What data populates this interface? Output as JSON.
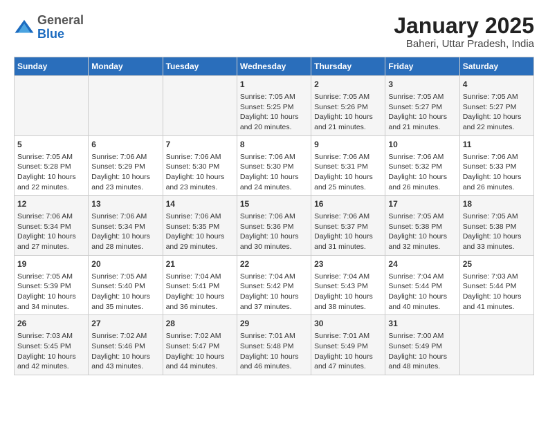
{
  "header": {
    "logo_general": "General",
    "logo_blue": "Blue",
    "title": "January 2025",
    "subtitle": "Baheri, Uttar Pradesh, India"
  },
  "calendar": {
    "days_of_week": [
      "Sunday",
      "Monday",
      "Tuesday",
      "Wednesday",
      "Thursday",
      "Friday",
      "Saturday"
    ],
    "weeks": [
      [
        {
          "day": null,
          "info": null
        },
        {
          "day": null,
          "info": null
        },
        {
          "day": null,
          "info": null
        },
        {
          "day": "1",
          "info": "Sunrise: 7:05 AM\nSunset: 5:25 PM\nDaylight: 10 hours\nand 20 minutes."
        },
        {
          "day": "2",
          "info": "Sunrise: 7:05 AM\nSunset: 5:26 PM\nDaylight: 10 hours\nand 21 minutes."
        },
        {
          "day": "3",
          "info": "Sunrise: 7:05 AM\nSunset: 5:27 PM\nDaylight: 10 hours\nand 21 minutes."
        },
        {
          "day": "4",
          "info": "Sunrise: 7:05 AM\nSunset: 5:27 PM\nDaylight: 10 hours\nand 22 minutes."
        }
      ],
      [
        {
          "day": "5",
          "info": "Sunrise: 7:05 AM\nSunset: 5:28 PM\nDaylight: 10 hours\nand 22 minutes."
        },
        {
          "day": "6",
          "info": "Sunrise: 7:06 AM\nSunset: 5:29 PM\nDaylight: 10 hours\nand 23 minutes."
        },
        {
          "day": "7",
          "info": "Sunrise: 7:06 AM\nSunset: 5:30 PM\nDaylight: 10 hours\nand 23 minutes."
        },
        {
          "day": "8",
          "info": "Sunrise: 7:06 AM\nSunset: 5:30 PM\nDaylight: 10 hours\nand 24 minutes."
        },
        {
          "day": "9",
          "info": "Sunrise: 7:06 AM\nSunset: 5:31 PM\nDaylight: 10 hours\nand 25 minutes."
        },
        {
          "day": "10",
          "info": "Sunrise: 7:06 AM\nSunset: 5:32 PM\nDaylight: 10 hours\nand 26 minutes."
        },
        {
          "day": "11",
          "info": "Sunrise: 7:06 AM\nSunset: 5:33 PM\nDaylight: 10 hours\nand 26 minutes."
        }
      ],
      [
        {
          "day": "12",
          "info": "Sunrise: 7:06 AM\nSunset: 5:34 PM\nDaylight: 10 hours\nand 27 minutes."
        },
        {
          "day": "13",
          "info": "Sunrise: 7:06 AM\nSunset: 5:34 PM\nDaylight: 10 hours\nand 28 minutes."
        },
        {
          "day": "14",
          "info": "Sunrise: 7:06 AM\nSunset: 5:35 PM\nDaylight: 10 hours\nand 29 minutes."
        },
        {
          "day": "15",
          "info": "Sunrise: 7:06 AM\nSunset: 5:36 PM\nDaylight: 10 hours\nand 30 minutes."
        },
        {
          "day": "16",
          "info": "Sunrise: 7:06 AM\nSunset: 5:37 PM\nDaylight: 10 hours\nand 31 minutes."
        },
        {
          "day": "17",
          "info": "Sunrise: 7:05 AM\nSunset: 5:38 PM\nDaylight: 10 hours\nand 32 minutes."
        },
        {
          "day": "18",
          "info": "Sunrise: 7:05 AM\nSunset: 5:38 PM\nDaylight: 10 hours\nand 33 minutes."
        }
      ],
      [
        {
          "day": "19",
          "info": "Sunrise: 7:05 AM\nSunset: 5:39 PM\nDaylight: 10 hours\nand 34 minutes."
        },
        {
          "day": "20",
          "info": "Sunrise: 7:05 AM\nSunset: 5:40 PM\nDaylight: 10 hours\nand 35 minutes."
        },
        {
          "day": "21",
          "info": "Sunrise: 7:04 AM\nSunset: 5:41 PM\nDaylight: 10 hours\nand 36 minutes."
        },
        {
          "day": "22",
          "info": "Sunrise: 7:04 AM\nSunset: 5:42 PM\nDaylight: 10 hours\nand 37 minutes."
        },
        {
          "day": "23",
          "info": "Sunrise: 7:04 AM\nSunset: 5:43 PM\nDaylight: 10 hours\nand 38 minutes."
        },
        {
          "day": "24",
          "info": "Sunrise: 7:04 AM\nSunset: 5:44 PM\nDaylight: 10 hours\nand 40 minutes."
        },
        {
          "day": "25",
          "info": "Sunrise: 7:03 AM\nSunset: 5:44 PM\nDaylight: 10 hours\nand 41 minutes."
        }
      ],
      [
        {
          "day": "26",
          "info": "Sunrise: 7:03 AM\nSunset: 5:45 PM\nDaylight: 10 hours\nand 42 minutes."
        },
        {
          "day": "27",
          "info": "Sunrise: 7:02 AM\nSunset: 5:46 PM\nDaylight: 10 hours\nand 43 minutes."
        },
        {
          "day": "28",
          "info": "Sunrise: 7:02 AM\nSunset: 5:47 PM\nDaylight: 10 hours\nand 44 minutes."
        },
        {
          "day": "29",
          "info": "Sunrise: 7:01 AM\nSunset: 5:48 PM\nDaylight: 10 hours\nand 46 minutes."
        },
        {
          "day": "30",
          "info": "Sunrise: 7:01 AM\nSunset: 5:49 PM\nDaylight: 10 hours\nand 47 minutes."
        },
        {
          "day": "31",
          "info": "Sunrise: 7:00 AM\nSunset: 5:49 PM\nDaylight: 10 hours\nand 48 minutes."
        },
        {
          "day": null,
          "info": null
        }
      ]
    ]
  }
}
